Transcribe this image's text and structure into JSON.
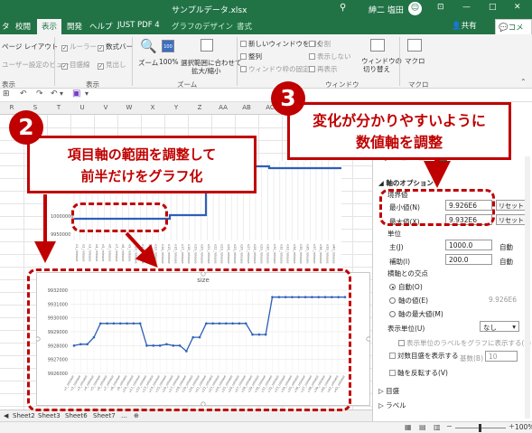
{
  "titlebar": {
    "file_title": "サンプルデータ.xlsx",
    "search_icon": "search-icon",
    "user_name": "紳二 塩田",
    "minimize": "—",
    "restore": "□",
    "close": "✕"
  },
  "ribbon_tabs": [
    "タ",
    "校閲",
    "表示",
    "開発",
    "ヘルプ",
    "JUST PDF 4",
    "グラフのデザイン",
    "書式"
  ],
  "share_label": "共有",
  "comment_label": "コメント",
  "ribbon": {
    "page_layout": "ページ レイアウト",
    "user_view": "ユーザー設定のビュー",
    "ruler": "ルーラー",
    "formula_bar": "数式バー",
    "gridlines": "目盛線",
    "headings": "見出し",
    "zoom": "ズーム",
    "zoom100": "100%",
    "zoom_sel_l1": "選択範囲に合わせて",
    "zoom_sel_l2": "拡大/縮小",
    "new_window": "新しいウィンドウを開く",
    "arrange": "整列",
    "freeze": "ウィンドウ枠の固定",
    "split": "分割",
    "hide": "表示しない",
    "unhide": "再表示",
    "switch_l1": "ウィンドウの",
    "switch_l2": "切り替え",
    "macro": "マクロ",
    "group_show": "表示",
    "group_zoom": "ズーム",
    "group_window": "ウィンドウ",
    "group_macro": "マクロ"
  },
  "columns": [
    "R",
    "S",
    "T",
    "U",
    "V",
    "W",
    "X",
    "Y",
    "Z",
    "AA",
    "AB",
    "AC",
    "AD",
    "AE",
    "AF",
    "AG"
  ],
  "sheet_tabs": [
    "Sheet2",
    "Sheet3",
    "Sheet6",
    "Sheet7"
  ],
  "status": {
    "zoom": "100%"
  },
  "chart_top": {
    "ytick_labels": [
      "10000000",
      "9950000"
    ]
  },
  "chart_data": [
    {
      "type": "line",
      "title": "",
      "ylim": [
        9926000,
        9932000
      ],
      "yticks": [
        "9932000",
        "9931000",
        "9930000",
        "9929000",
        "9928000",
        "9927000",
        "9926000"
      ],
      "series": [
        {
          "name": "size",
          "values": [
            9928000,
            9928100,
            9928100,
            9928600,
            9929600,
            9929600,
            9929600,
            9929600,
            9929600,
            9929600,
            9929600,
            9928000,
            9928000,
            9928000,
            9928100,
            9928000,
            9928000,
            9927600,
            9928600,
            9928600,
            9929600,
            9929600,
            9929600,
            9929600,
            9929600,
            9929600,
            9929600,
            9928800,
            9928800,
            9928800,
            9931500,
            9931500,
            9931500,
            9931500,
            9931500,
            9931500,
            9931500,
            9931500,
            9931500,
            9931500,
            9931500,
            9931500
          ]
        }
      ]
    }
  ],
  "chart_bottom": {
    "title": "size"
  },
  "panel": {
    "section_axis": "軸のオプション",
    "bounds": "境界値",
    "min_label": "最小値(N)",
    "min_value": "9.926E6",
    "max_label": "最大値(X)",
    "max_value": "9.932E6",
    "reset": "リセット",
    "units": "単位",
    "major": "主(J)",
    "major_value": "1000.0",
    "minor": "補助(I)",
    "minor_value": "200.0",
    "auto": "自動",
    "cross": "横軸との交点",
    "cross_auto": "自動(O)",
    "cross_value": "軸の値(E)",
    "cross_value_num": "9.926E6",
    "cross_max": "軸の最大値(M)",
    "display_units": "表示単位(U)",
    "display_units_val": "なし",
    "show_units_label": "表示単位のラベルをグラフに表示する(S)",
    "log_scale": "対数目盛を表示する",
    "base": "基数(B)",
    "base_val": "10",
    "reverse": "軸を反転する(V)",
    "ticks": "目盛",
    "labels": "ラベル"
  },
  "callouts": {
    "badge2": "2",
    "text2_l1": "項目軸の範囲を調整して",
    "text2_l2": "前半だけをグラフ化",
    "badge3": "3",
    "text3_l1": "変化が分かりやすいように",
    "text3_l2": "数値軸を調整"
  },
  "colors": {
    "excel_green": "#217346",
    "callout_red": "#c00000",
    "series_blue": "#2e5fb8"
  }
}
